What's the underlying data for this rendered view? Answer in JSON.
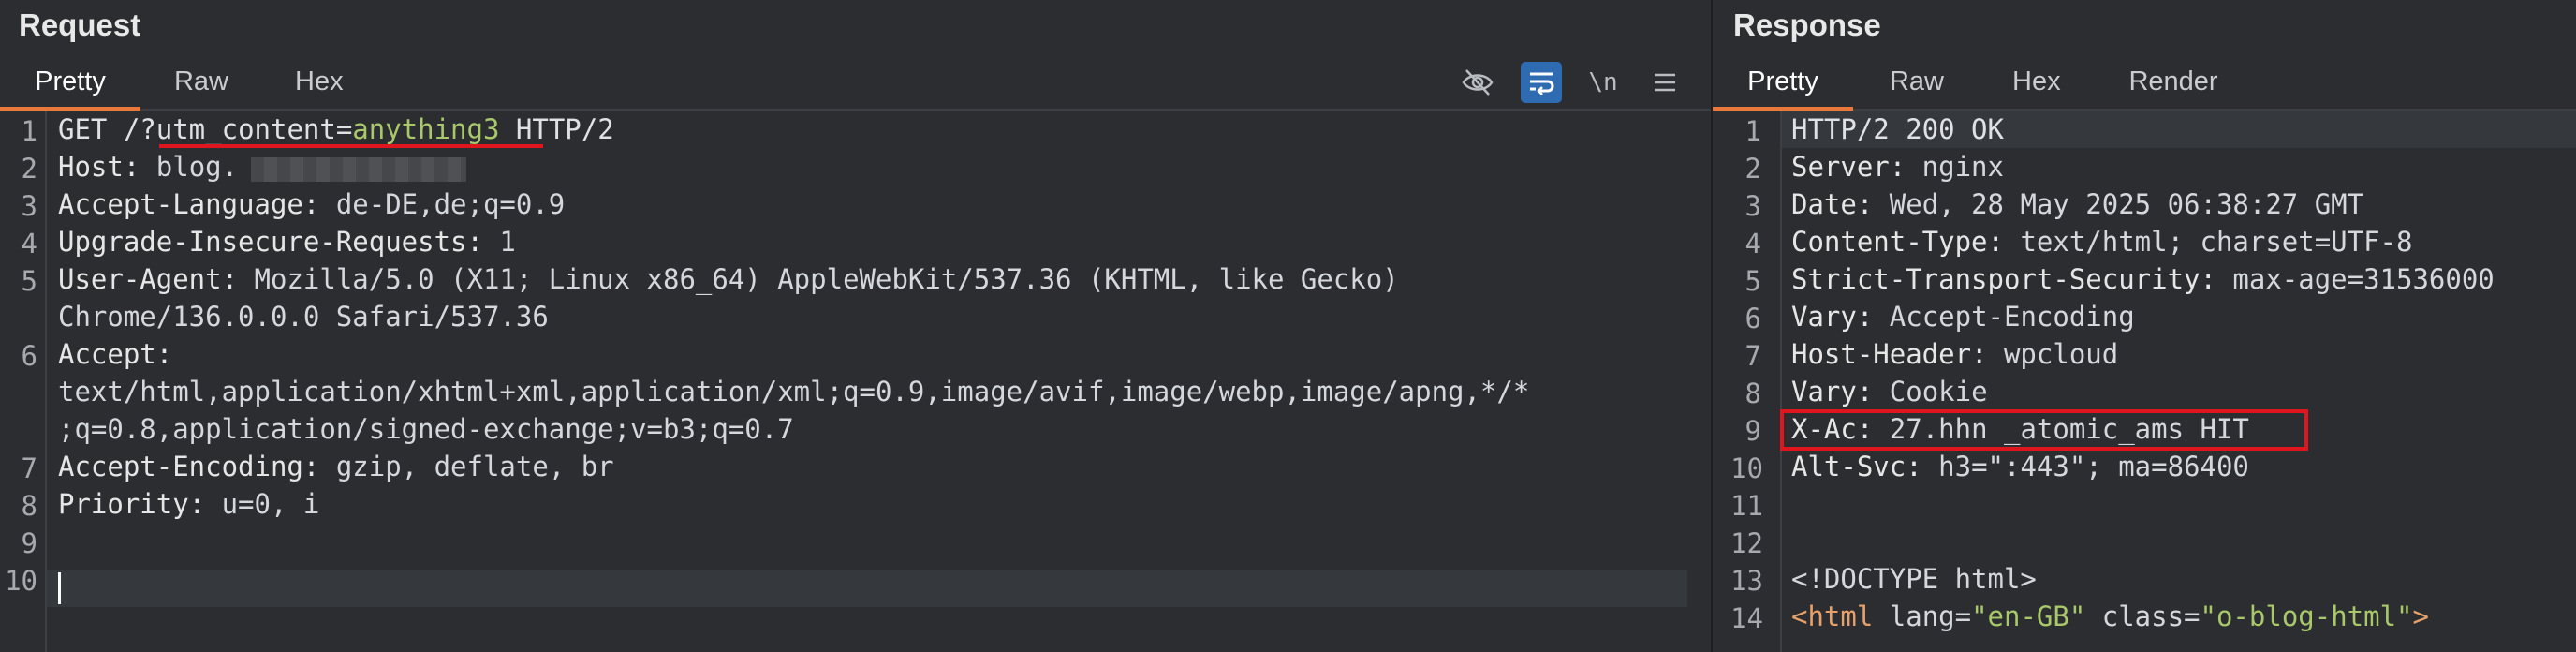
{
  "request": {
    "title": "Request",
    "tabs": [
      "Pretty",
      "Raw",
      "Hex"
    ],
    "tools": {
      "hide_icon": "eye-slash-icon",
      "wrap_icon": "wrap-text-icon",
      "newline_label": "\\n",
      "menu_icon": "hamburger-menu-icon"
    },
    "line_numbers": [
      "1",
      "2",
      "3",
      "4",
      "5",
      "6",
      "7",
      "8",
      "9",
      "10"
    ],
    "lines": {
      "l1_method": "GET /?",
      "l1_param": "utm_content",
      "l1_eq": "=",
      "l1_value": "anything3",
      "l1_proto": " HTTP/2",
      "l2_key": "Host:",
      "l2_val": " blog.",
      "l3_key": "Accept-Language:",
      "l3_val": " de-DE,de;q=0.9",
      "l4_key": "Upgrade-Insecure-Requests:",
      "l4_val": " 1",
      "l5_key": "User-Agent:",
      "l5_val": " Mozilla/5.0 (X11; Linux x86_64) AppleWebKit/537.36 (KHTML, like Gecko)",
      "l5_cont": "Chrome/136.0.0.0 Safari/537.36",
      "l6_key": "Accept:",
      "l6_cont1": "text/html,application/xhtml+xml,application/xml;q=0.9,image/avif,image/webp,image/apng,*/*",
      "l6_cont2": ";q=0.8,application/signed-exchange;v=b3;q=0.7",
      "l7_key": "Accept-Encoding:",
      "l7_val": " gzip, deflate, br",
      "l8_key": "Priority:",
      "l8_val": " u=0, i"
    }
  },
  "response": {
    "title": "Response",
    "tabs": [
      "Pretty",
      "Raw",
      "Hex",
      "Render"
    ],
    "line_numbers": [
      "1",
      "2",
      "3",
      "4",
      "5",
      "6",
      "7",
      "8",
      "9",
      "10",
      "11",
      "12",
      "13",
      "14"
    ],
    "lines": {
      "l1": "HTTP/2 200 OK",
      "l2_key": "Server:",
      "l2_val": " nginx",
      "l3_key": "Date:",
      "l3_val": " Wed, 28 May 2025 06:38:27 GMT",
      "l4_key": "Content-Type:",
      "l4_val": " text/html; charset=UTF-8",
      "l5_key": "Strict-Transport-Security:",
      "l5_val": " max-age=31536000",
      "l6_key": "Vary:",
      "l6_val": " Accept-Encoding",
      "l7_key": "Host-Header:",
      "l7_val": " wpcloud",
      "l8_key": "Vary:",
      "l8_val": " Cookie",
      "l9_key": "X-Ac:",
      "l9_val": " 27.hhn _atomic_ams HIT",
      "l10_key": "Alt-Svc:",
      "l10_val": " h3=\":443\"; ma=86400",
      "l13": "<!DOCTYPE html>",
      "l14_tag": "<html",
      "l14_a1": " lang=",
      "l14_v1": "\"en-GB\"",
      "l14_a2": " class=",
      "l14_v2": "\"o-blog-html\"",
      "l14_end": ">"
    }
  },
  "colors": {
    "background": "#2b2d30",
    "accent_tab": "#e8793a",
    "highlight_box": "#e0161e",
    "param_value": "#a8c86a",
    "wrap_active": "#2f6bb0"
  }
}
